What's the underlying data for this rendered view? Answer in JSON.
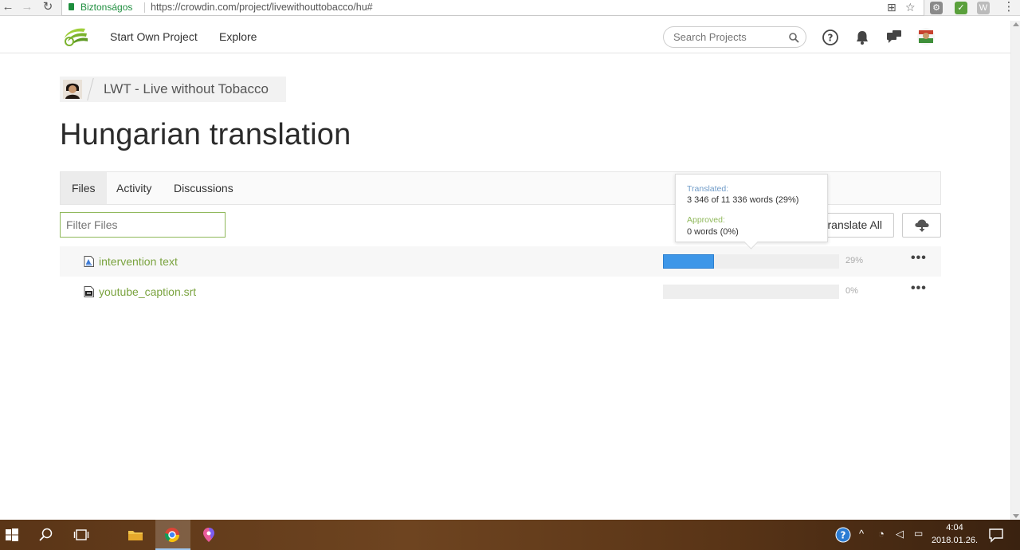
{
  "browser": {
    "secure_label": "Biztonságos",
    "url": "https://crowdin.com/project/livewithouttobacco/hu#"
  },
  "header": {
    "nav": [
      "Start Own Project",
      "Explore"
    ],
    "search_placeholder": "Search Projects"
  },
  "breadcrumb": {
    "project": "LWT - Live without Tobacco"
  },
  "page": {
    "title": "Hungarian translation"
  },
  "tabs": [
    {
      "label": "Files",
      "active": true
    },
    {
      "label": "Activity",
      "active": false
    },
    {
      "label": "Discussions",
      "active": false
    }
  ],
  "toolbar": {
    "filter_placeholder": "Filter Files",
    "translate_all_label": "Translate All"
  },
  "files": [
    {
      "name": "intervention text",
      "progress": 29,
      "progress_label": "29%",
      "type": "doc"
    },
    {
      "name": "youtube_caption.srt",
      "progress": 0,
      "progress_label": "0%",
      "type": "srt"
    }
  ],
  "tooltip": {
    "translated_label": "Translated:",
    "translated_value": "3 346 of 11 336 words (29%)",
    "approved_label": "Approved:",
    "approved_value": "0 words (0%)"
  },
  "taskbar": {
    "time": "4:04",
    "date": "2018.01.26."
  },
  "colors": {
    "brand_green": "#7aa33f",
    "progress_blue": "#3e97e8"
  }
}
